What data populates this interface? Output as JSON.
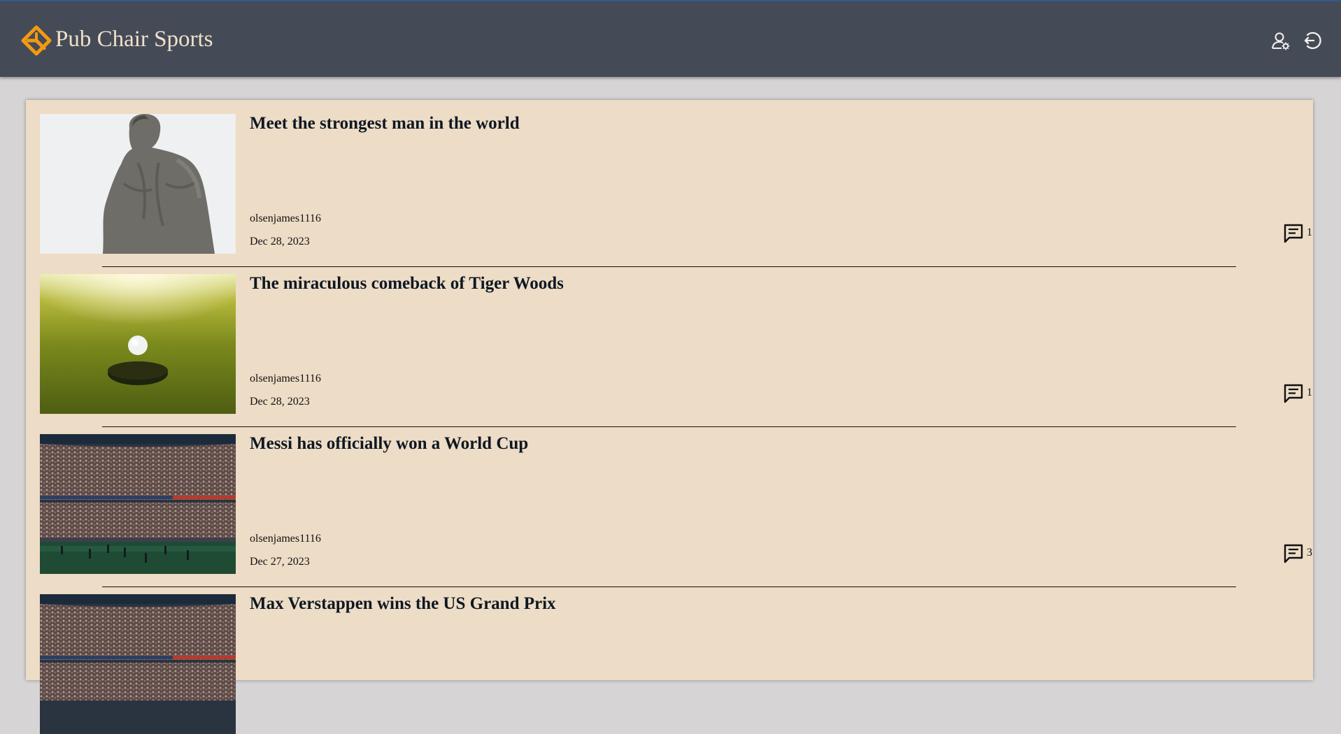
{
  "header": {
    "brand": "Pub Chair Sports",
    "logo_icon": "diamond-chair-logo",
    "profile_settings_icon": "user-gear-icon",
    "logout_icon": "logout-icon"
  },
  "colors": {
    "header_bg": "#454b56",
    "brand_text": "#efe2c9",
    "logo": "#f29a12",
    "card_bg": "#eddcc6",
    "page_bg": "#d6d4d4"
  },
  "articles": [
    {
      "title": "Meet the strongest man in the world",
      "author": "olsenjames1116",
      "date": "Dec 28, 2023",
      "comment_count": "1",
      "image": "statue-back-photo"
    },
    {
      "title": "The miraculous comeback of Tiger Woods",
      "author": "olsenjames1116",
      "date": "Dec 28, 2023",
      "comment_count": "1",
      "image": "golf-ball-hole-photo"
    },
    {
      "title": "Messi has officially won a World Cup",
      "author": "olsenjames1116",
      "date": "Dec 27, 2023",
      "comment_count": "3",
      "image": "stadium-crowd-photo"
    },
    {
      "title": "Max Verstappen wins the US Grand Prix",
      "author": "",
      "date": "",
      "comment_count": "",
      "image": "stadium-crowd-photo"
    }
  ]
}
